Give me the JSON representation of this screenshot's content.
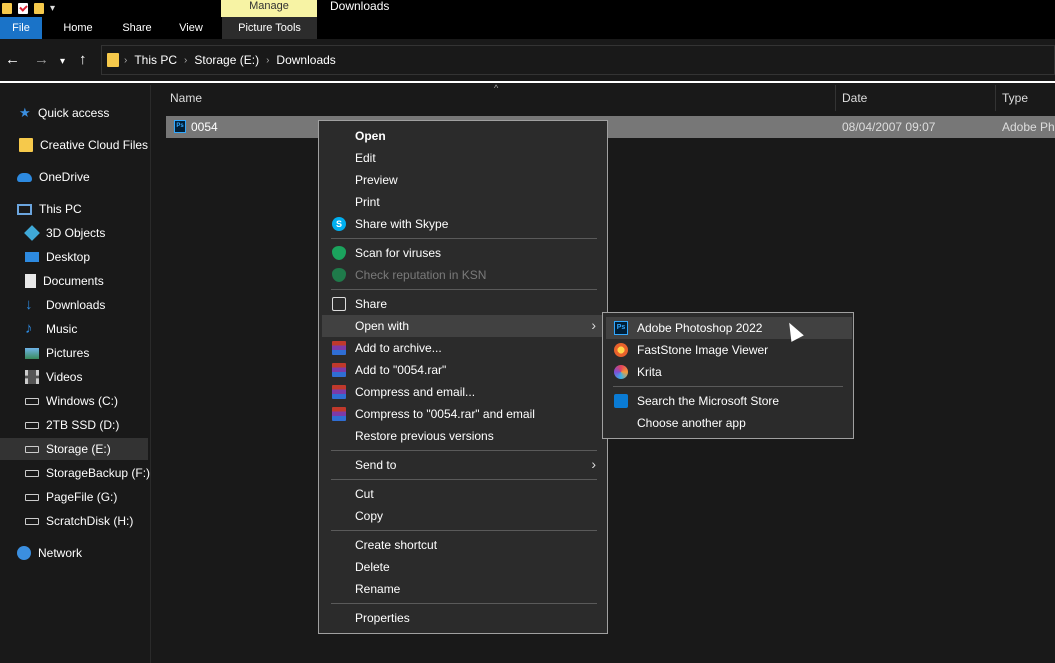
{
  "ribbon": {
    "context_tab": "Manage",
    "window_title": "Downloads",
    "tabs": [
      "File",
      "Home",
      "Share",
      "View",
      "Picture Tools"
    ]
  },
  "address": {
    "crumbs": [
      "This PC",
      "Storage (E:)",
      "Downloads"
    ]
  },
  "sidebar": {
    "items": [
      {
        "label": "Quick access",
        "icon": "star-icon"
      },
      {
        "label": "Creative Cloud Files",
        "icon": "cloud-folder-icon"
      },
      {
        "label": "OneDrive",
        "icon": "onedrive-icon"
      },
      {
        "label": "This PC",
        "icon": "computer-icon"
      },
      {
        "label": "3D Objects",
        "icon": "cube-icon"
      },
      {
        "label": "Desktop",
        "icon": "desktop-icon"
      },
      {
        "label": "Documents",
        "icon": "document-icon"
      },
      {
        "label": "Downloads",
        "icon": "download-icon"
      },
      {
        "label": "Music",
        "icon": "music-icon"
      },
      {
        "label": "Pictures",
        "icon": "pictures-icon"
      },
      {
        "label": "Videos",
        "icon": "video-icon"
      },
      {
        "label": "Windows (C:)",
        "icon": "drive-icon"
      },
      {
        "label": "2TB SSD (D:)",
        "icon": "drive-icon"
      },
      {
        "label": "Storage (E:)",
        "icon": "drive-icon"
      },
      {
        "label": "StorageBackup (F:)",
        "icon": "drive-icon"
      },
      {
        "label": "PageFile (G:)",
        "icon": "drive-icon"
      },
      {
        "label": "ScratchDisk (H:)",
        "icon": "drive-icon"
      },
      {
        "label": "Network",
        "icon": "network-icon"
      }
    ]
  },
  "columns": {
    "name": "Name",
    "date": "Date",
    "type": "Type"
  },
  "file": {
    "name": "0054",
    "date": "08/04/2007 09:07",
    "type": "Adobe Ph"
  },
  "context_menu": {
    "items": [
      "Open",
      "Edit",
      "Preview",
      "Print",
      "Share with Skype",
      "Scan for viruses",
      "Check reputation in KSN",
      "Share",
      "Open with",
      "Add to archive...",
      "Add to \"0054.rar\"",
      "Compress and email...",
      "Compress to \"0054.rar\" and email",
      "Restore previous versions",
      "Send to",
      "Cut",
      "Copy",
      "Create shortcut",
      "Delete",
      "Rename",
      "Properties"
    ]
  },
  "open_with_menu": {
    "items": [
      "Adobe Photoshop 2022",
      "FastStone Image Viewer",
      "Krita",
      "Search the Microsoft Store",
      "Choose another app"
    ]
  },
  "colors": {
    "background": "#191919",
    "file_tab": "#1a73c8",
    "manage_tab": "#f7f3a4",
    "selected_row": "#777777",
    "menu_bg": "#2b2b2b"
  }
}
